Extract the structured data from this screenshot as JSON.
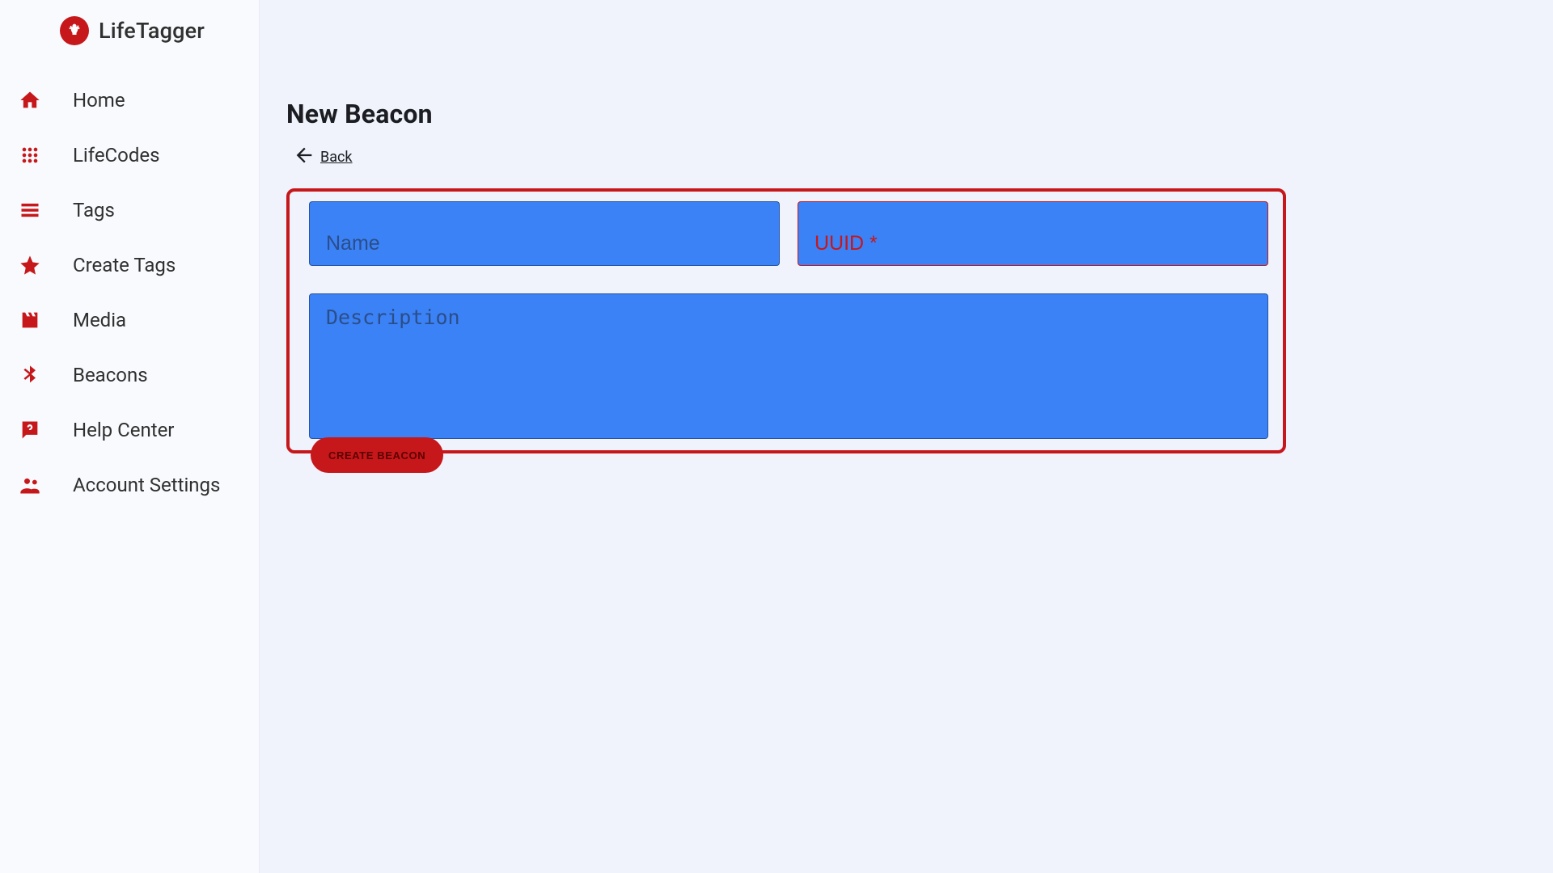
{
  "brand": {
    "name": "LifeTagger"
  },
  "sidebar": {
    "items": [
      {
        "label": "Home",
        "icon": "home-icon"
      },
      {
        "label": "LifeCodes",
        "icon": "dots-grid-icon"
      },
      {
        "label": "Tags",
        "icon": "list-icon"
      },
      {
        "label": "Create Tags",
        "icon": "star-icon"
      },
      {
        "label": "Media",
        "icon": "movie-filter-icon"
      },
      {
        "label": "Beacons",
        "icon": "bluetooth-icon"
      },
      {
        "label": "Help Center",
        "icon": "help-chat-icon"
      },
      {
        "label": "Account Settings",
        "icon": "people-icon"
      }
    ]
  },
  "page": {
    "title": "New Beacon",
    "back_label": "Back"
  },
  "form": {
    "name": {
      "placeholder": "Name",
      "value": ""
    },
    "uuid": {
      "placeholder": "UUID *",
      "value": ""
    },
    "description": {
      "placeholder": "Description",
      "value": ""
    },
    "submit_label": "CREATE BEACON"
  },
  "colors": {
    "accent_red": "#c6171b",
    "field_blue": "#3b82f6",
    "page_bg": "#f0f3fb",
    "sidebar_bg": "#f8fafd"
  }
}
